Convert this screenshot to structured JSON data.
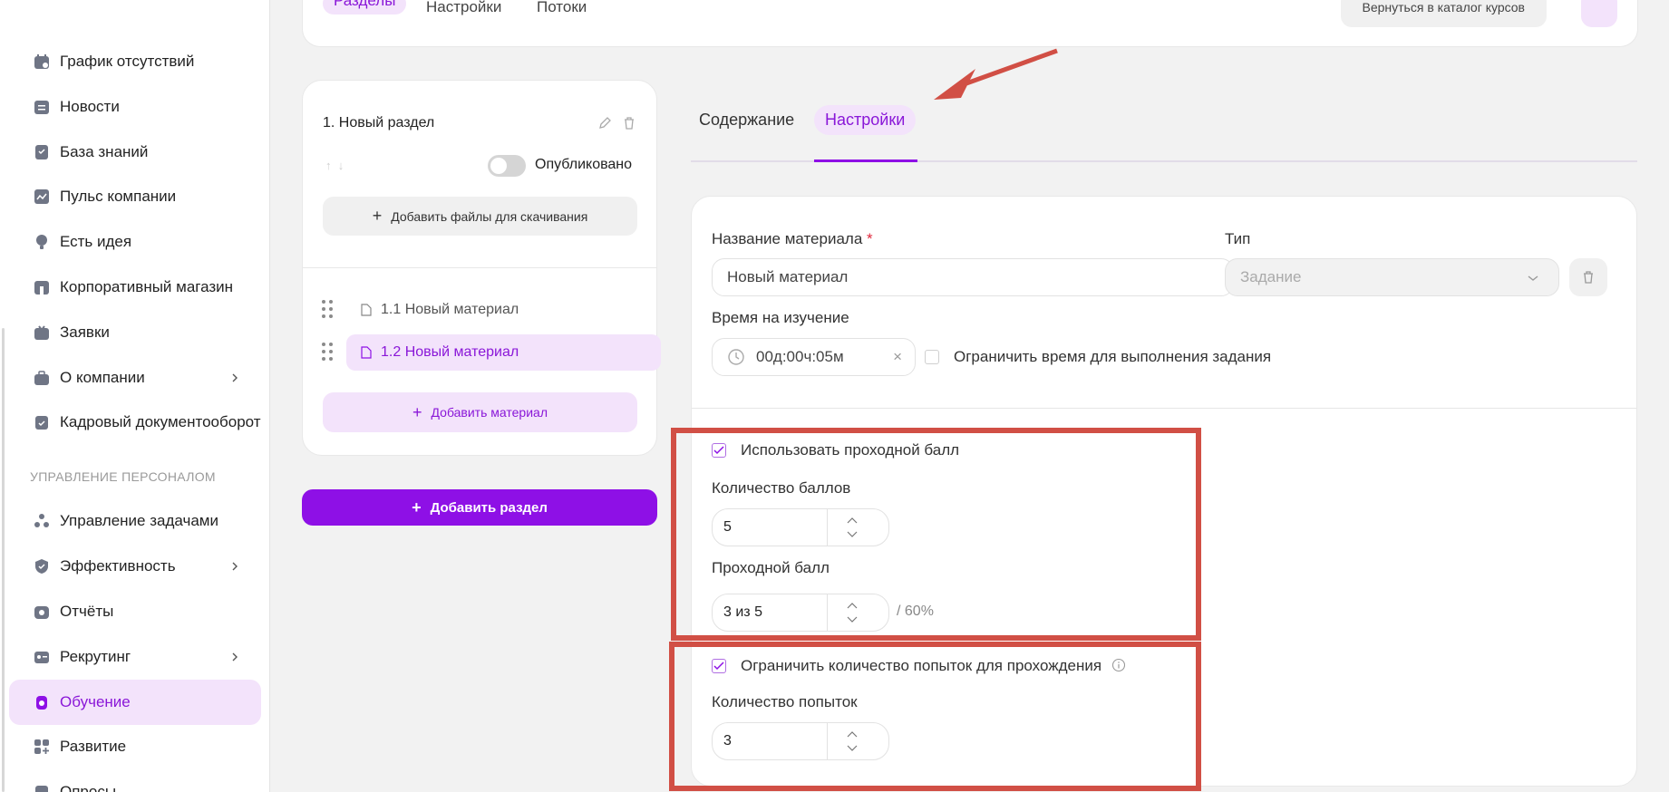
{
  "sidebar": {
    "items": [
      {
        "label": "График отсутствий",
        "icon": "calendar-icon"
      },
      {
        "label": "Новости",
        "icon": "news-icon"
      },
      {
        "label": "База знаний",
        "icon": "book-icon"
      },
      {
        "label": "Пульс компании",
        "icon": "pulse-chart-icon"
      },
      {
        "label": "Есть идея",
        "icon": "lightbulb-icon"
      },
      {
        "label": "Корпоративный магазин",
        "icon": "shop-icon"
      },
      {
        "label": "Заявки",
        "icon": "inbox-icon"
      },
      {
        "label": "О компании",
        "icon": "briefcase-icon"
      },
      {
        "label": "Кадровый документооборот",
        "icon": "clipboard-icon"
      }
    ],
    "section_title": "УПРАВЛЕНИЕ ПЕРСОНАЛОМ",
    "items2": [
      {
        "label": "Управление задачами",
        "icon": "tasks-icon"
      },
      {
        "label": "Эффективность",
        "icon": "shield-icon"
      },
      {
        "label": "Отчёты",
        "icon": "reports-icon"
      },
      {
        "label": "Рекрутинг",
        "icon": "recruiting-icon"
      },
      {
        "label": "Обучение",
        "icon": "learning-icon"
      },
      {
        "label": "Развитие",
        "icon": "development-icon"
      },
      {
        "label": "Опросы",
        "icon": "survey-icon"
      }
    ]
  },
  "header": {
    "tabs": [
      "Разделы",
      "Настройки",
      "Потоки"
    ],
    "back_button": "Вернуться в каталог курсов"
  },
  "section": {
    "title": "1. Новый раздел",
    "published_label": "Опубликовано",
    "add_files": "Добавить файлы для скачивания",
    "materials": [
      "1.1 Новый материал",
      "1.2 Новый материал"
    ],
    "add_material": "Добавить материал",
    "add_section": "Добавить раздел"
  },
  "content_tabs": {
    "content": "Содержание",
    "settings": "Настройки"
  },
  "settings": {
    "name_label": "Название материала",
    "required_mark": "*",
    "name_value": "Новый материал",
    "type_label": "Тип",
    "type_value": "Задание",
    "study_time_label": "Время на изучение",
    "study_time_value": "00д:00ч:05м",
    "clear_symbol": "×",
    "limit_time_label": "Ограничить время для выполнения задания",
    "use_pass_score_label": "Использовать проходной балл",
    "points_label": "Количество баллов",
    "points_value": "5",
    "pass_score_label": "Проходной балл",
    "pass_score_value": "3 из 5",
    "pass_score_percent": "/ 60%",
    "limit_attempts_label": "Ограничить количество попыток для прохождения",
    "attempts_label": "Количество попыток",
    "attempts_value": "3"
  },
  "colors": {
    "accent": "#8e10e6",
    "accent_light": "#f3e3fb",
    "annotation": "#d14f45"
  }
}
